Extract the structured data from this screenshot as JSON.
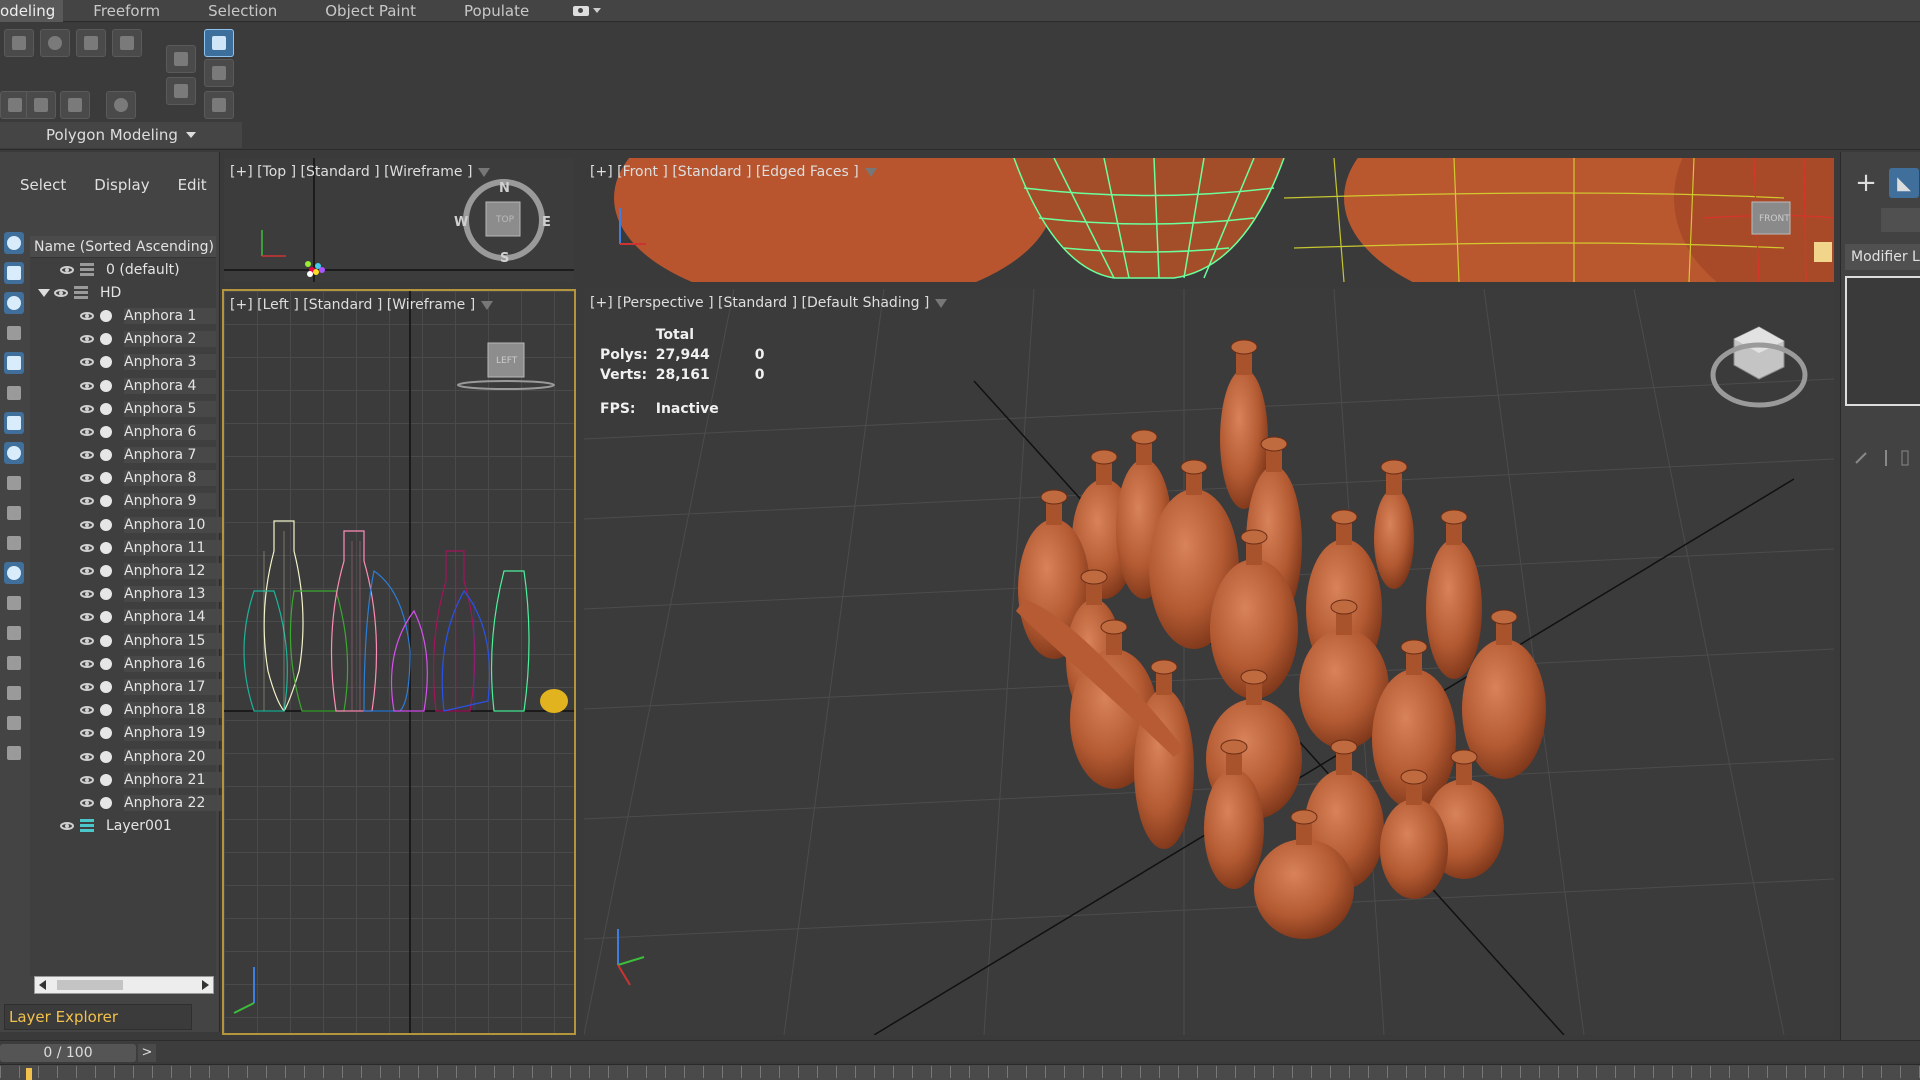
{
  "ribbon": {
    "tabs": [
      {
        "label": "odeling",
        "active": true
      },
      {
        "label": "Freeform"
      },
      {
        "label": "Selection"
      },
      {
        "label": "Object Paint"
      },
      {
        "label": "Populate"
      }
    ],
    "panel_label": "Polygon Modeling"
  },
  "explorer": {
    "menu": [
      "Select",
      "Display",
      "Edit"
    ],
    "column_header": "Name (Sorted Ascending)",
    "default_layer": "0 (default)",
    "group": "HD",
    "items": [
      "Anphora 1",
      "Anphora 2",
      "Anphora 3",
      "Anphora 4",
      "Anphora 5",
      "Anphora 6",
      "Anphora 7",
      "Anphora 8",
      "Anphora 9",
      "Anphora 10",
      "Anphora 11",
      "Anphora 12",
      "Anphora 13",
      "Anphora 14",
      "Anphora 15",
      "Anphora 16",
      "Anphora 17",
      "Anphora 18",
      "Anphora 19",
      "Anphora 20",
      "Anphora 21",
      "Anphora 22"
    ],
    "extra_layer": "Layer001",
    "footer_label": "Layer Explorer"
  },
  "viewports": {
    "top": {
      "label": "[+] [Top ] [Standard ] [Wireframe ]",
      "compass": {
        "n": "N",
        "s": "S",
        "e": "E",
        "w": "W",
        "cube": "TOP"
      }
    },
    "front": {
      "label": "[+] [Front ] [Standard ] [Edged Faces ]",
      "cube": "FRONT"
    },
    "left": {
      "label": "[+] [Left ] [Standard ] [Wireframe ]",
      "cube": "LEFT"
    },
    "perspective": {
      "label": "[+] [Perspective ] [Standard ] [Default Shading ]",
      "stats": {
        "header": "Total",
        "polys_label": "Polys:",
        "polys_total": "27,944",
        "polys_sel": "0",
        "verts_label": "Verts:",
        "verts_total": "28,161",
        "verts_sel": "0",
        "fps_label": "FPS:",
        "fps_value": "Inactive"
      }
    }
  },
  "command_panel": {
    "modifier_list": "Modifier List"
  },
  "timeline": {
    "frame": "0 / 100",
    "next": ">"
  },
  "colors": {
    "accent": "#f2c14b",
    "selected": "#3f6f9a",
    "terracotta": "#b05a33"
  }
}
